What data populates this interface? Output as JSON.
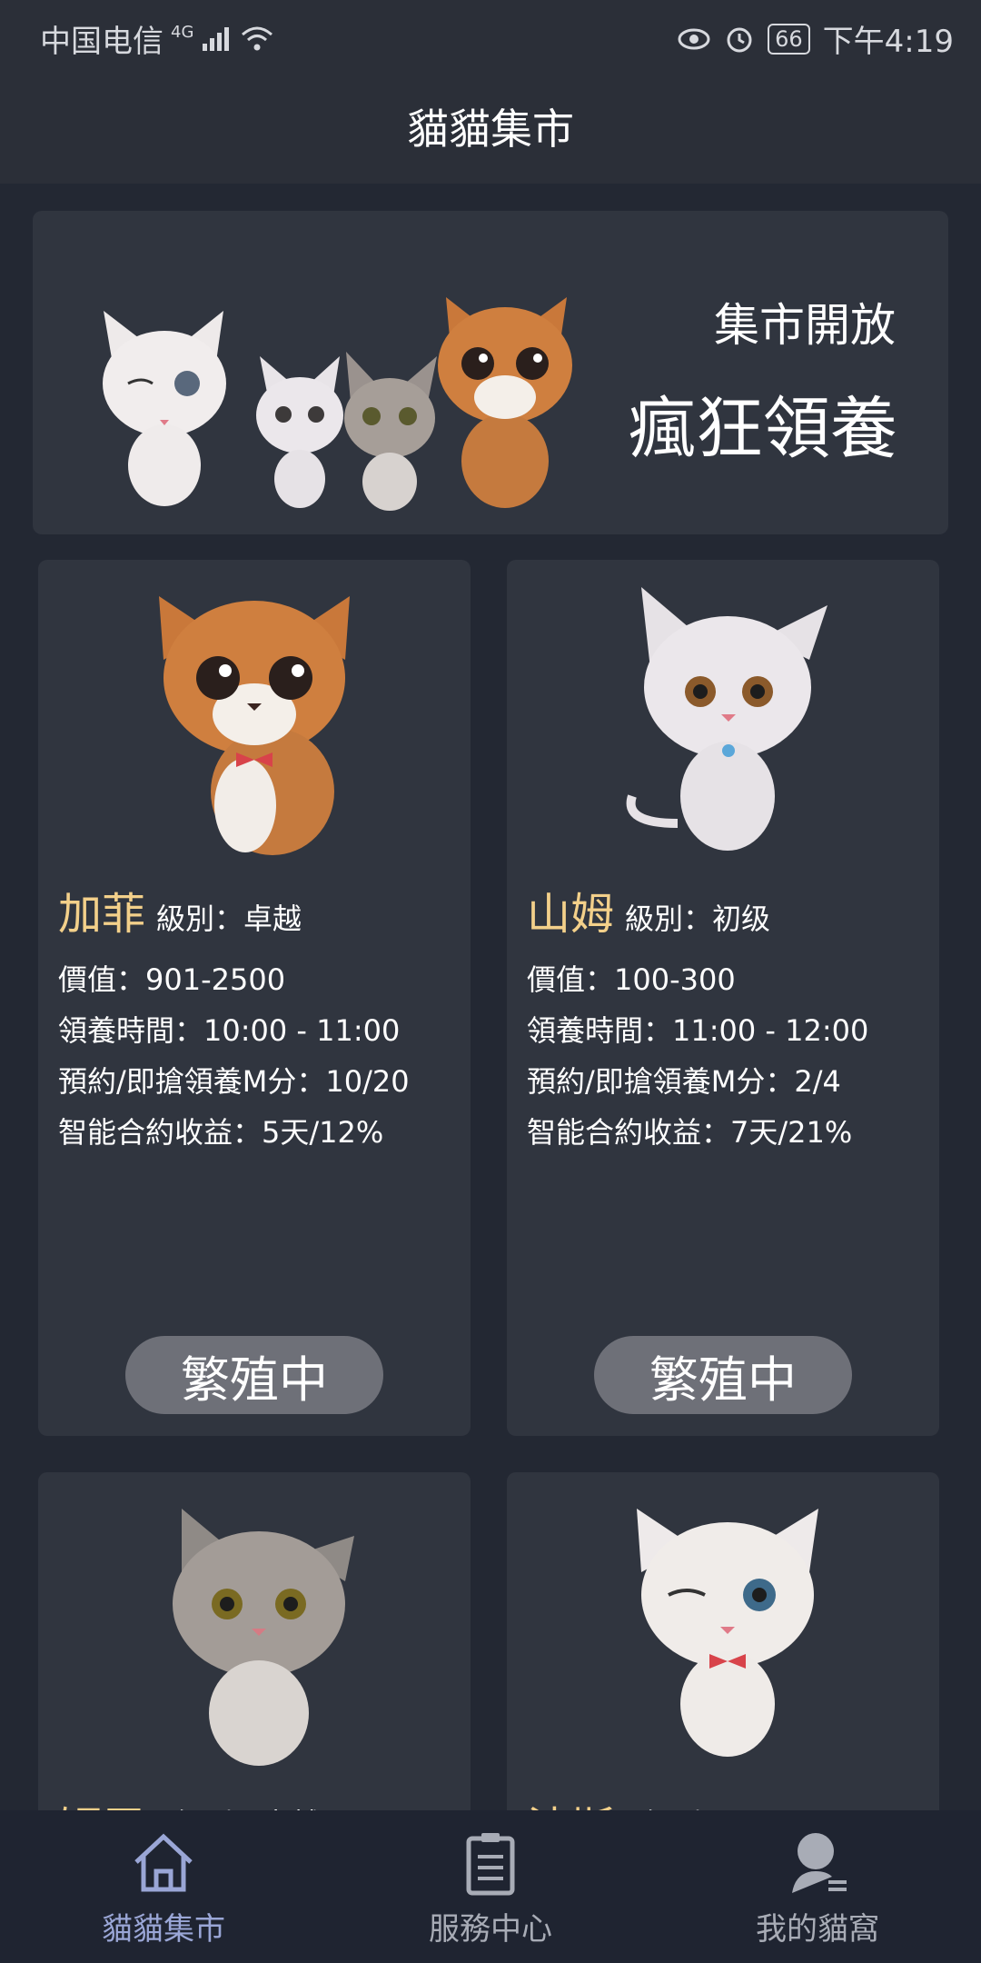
{
  "status_bar": {
    "carrier": "中国电信",
    "network": "4G",
    "battery": "66",
    "time": "下午4:19"
  },
  "header": {
    "title": "貓貓集市"
  },
  "banner": {
    "line1": "集市開放",
    "line2": "瘋狂領養"
  },
  "cards": [
    {
      "name": "加菲",
      "level": "級別：卓越",
      "value": "價值：901-2500",
      "time": "領養時間：10:00 - 11:00",
      "points": "預約/即搶領養M分：10/20",
      "income": "智能合約收益：5天/12%",
      "button": "繁殖中",
      "fur": "#c9783a"
    },
    {
      "name": "山姆",
      "level": "級別：初级",
      "value": "價值：100-300",
      "time": "領養時間：11:00 - 12:00",
      "points": "預約/即搶領養M分：2/4",
      "income": "智能合約收益：7天/21%",
      "button": "繁殖中",
      "fur": "#e9e6ea"
    },
    {
      "name": "短尾",
      "level": "級別：卓越",
      "fur": "#8f8a86"
    },
    {
      "name": "波斯",
      "level": "級別：",
      "fur": "#f0ece9"
    }
  ],
  "nav": {
    "items": [
      {
        "label": "貓貓集市",
        "icon": "home-icon"
      },
      {
        "label": "服務中心",
        "icon": "clipboard-icon"
      },
      {
        "label": "我的貓窩",
        "icon": "profile-icon"
      }
    ]
  },
  "colors": {
    "background": "#232833",
    "card": "#30353f",
    "name_accent": "#f3d08a",
    "button": "#6e7078",
    "nav_active": "#9aa6d6"
  }
}
